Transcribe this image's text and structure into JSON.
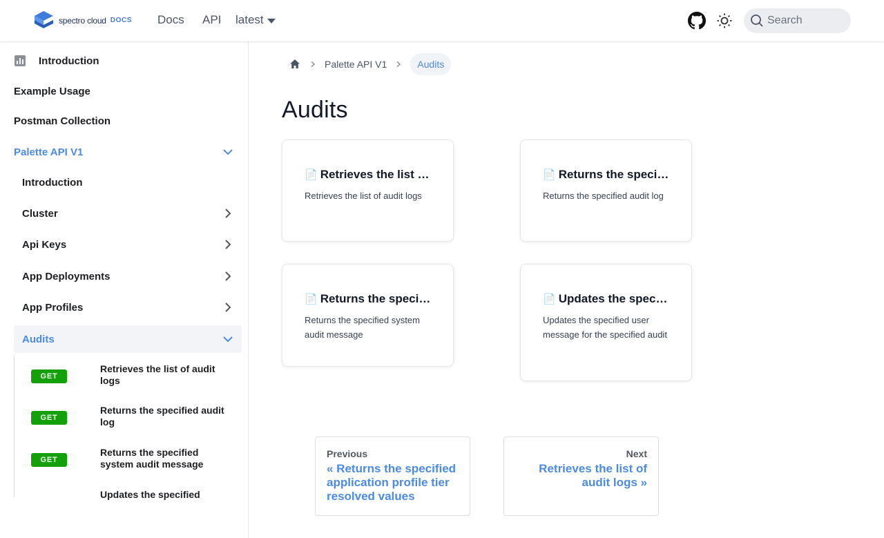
{
  "navbar": {
    "brand_name": "spectro cloud",
    "brand_suffix": "DOCS",
    "links": {
      "docs": "Docs",
      "api": "API",
      "version": "latest"
    },
    "search_placeholder": "Search"
  },
  "sidebar": {
    "intro": "Introduction",
    "example_usage": "Example Usage",
    "postman": "Postman Collection",
    "palette": "Palette API V1",
    "sub": {
      "introduction": "Introduction",
      "cluster": "Cluster",
      "api_keys": "Api Keys",
      "app_deployments": "App Deployments",
      "app_profiles": "App Profiles",
      "audits": "Audits"
    },
    "endpoints": [
      {
        "method": "GET",
        "label": "Retrieves the list of audit logs"
      },
      {
        "method": "GET",
        "label": "Returns the specified audit log"
      },
      {
        "method": "GET",
        "label": "Returns the specified system audit message"
      },
      {
        "method": "",
        "label": "Updates the specified"
      }
    ]
  },
  "breadcrumb": {
    "parent": "Palette API V1",
    "current": "Audits"
  },
  "page": {
    "title": "Audits"
  },
  "cards": [
    {
      "icon": "📄",
      "title": "Retrieves the list of audit logs",
      "desc": "Retrieves the list of audit logs"
    },
    {
      "icon": "📄",
      "title": "Returns the specified audit log",
      "desc": "Returns the specified audit log"
    },
    {
      "icon": "📄",
      "title": "Returns the specified system audit message",
      "desc": "Returns the specified system audit message"
    },
    {
      "icon": "📄",
      "title": "Updates the specified user message",
      "desc": "Updates the specified user message for the specified audit"
    }
  ],
  "pager": {
    "previous_sub": "Previous",
    "previous_label": "« Returns the specified application profile tier resolved values",
    "next_sub": "Next",
    "next_label": "Retrieves the list of audit logs »"
  },
  "colors": {
    "accent": "#4c8be2",
    "get_badge": "#14a00a",
    "brand": "#3f7bd8"
  }
}
